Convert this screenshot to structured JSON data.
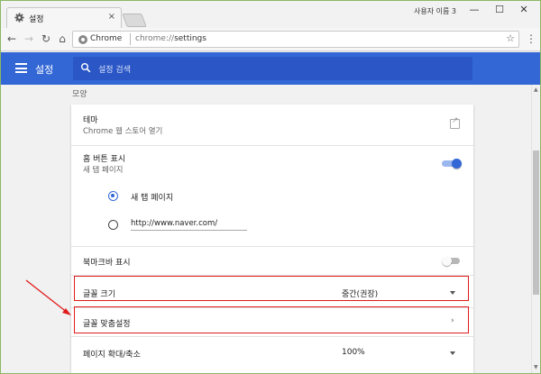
{
  "window": {
    "tab_title": "설정",
    "tab_close": "×",
    "profile": "사용자 이름 3",
    "minimize": "—",
    "maximize": "☐",
    "close": "✕"
  },
  "toolbar": {
    "back": "←",
    "forward": "→",
    "reload": "↻",
    "home": "⌂",
    "site_label": "Chrome",
    "url_scheme": "chrome://",
    "url_path": "settings",
    "star": "☆",
    "menu": "⋮"
  },
  "header": {
    "title": "설정",
    "search_placeholder": "설정 검색"
  },
  "appearance": {
    "section_title": "모양",
    "theme": {
      "label": "테마",
      "sub": "Chrome 웹 스토어 열기"
    },
    "home_button": {
      "label": "홈 버튼 표시",
      "sub": "새 탭 페이지",
      "enabled": true
    },
    "radio_newtab": {
      "label": "새 탭 페이지",
      "selected": true
    },
    "radio_url": {
      "value": "http://www.naver.com/",
      "selected": false
    },
    "bookmarks_bar": {
      "label": "북마크바 표시",
      "enabled": false
    },
    "font_size": {
      "label": "글꼴 크기",
      "value": "중간(권장)"
    },
    "font_custom": {
      "label": "글꼴 맞춤설정",
      "chevron": "›"
    },
    "page_zoom": {
      "label": "페이지 확대/축소",
      "value": "100%"
    }
  },
  "colors": {
    "accent": "#3367d6",
    "highlight": "#e01b1b",
    "toggle_on_track": "#9ab7f0",
    "toggle_off_track": "#b7b7b7"
  },
  "icons": [
    "gear-icon",
    "close-icon",
    "back-arrow-icon",
    "forward-arrow-icon",
    "reload-icon",
    "home-icon",
    "chrome-icon",
    "star-icon",
    "menu-icon",
    "hamburger-icon",
    "search-icon",
    "external-link-icon",
    "chevron-right-icon",
    "dropdown-arrow-icon"
  ]
}
